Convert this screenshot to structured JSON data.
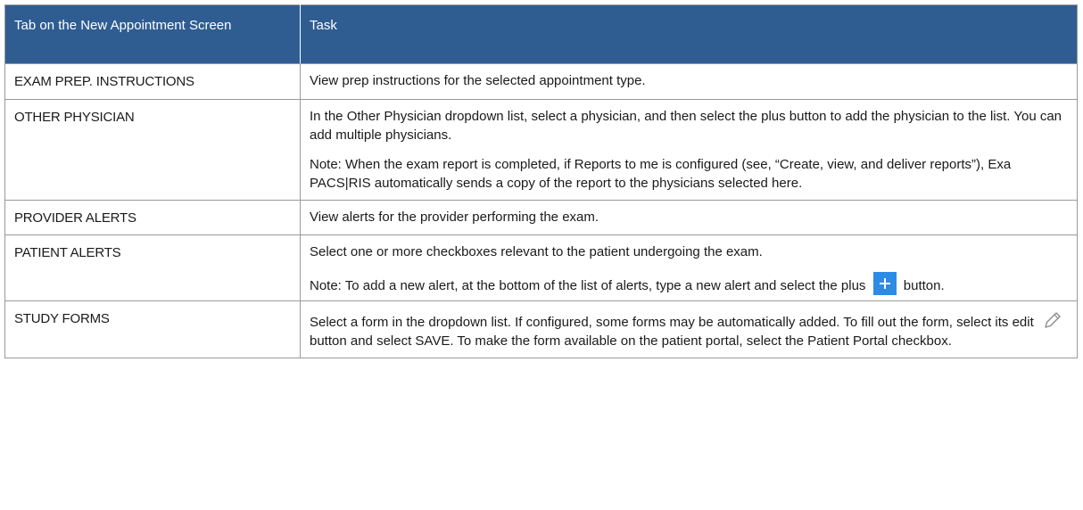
{
  "table": {
    "headers": [
      "Tab on the New Appointment Screen",
      "Task"
    ],
    "rows": {
      "exam_prep": {
        "tab": "EXAM PREP. INSTRUCTIONS",
        "task": [
          "View prep instructions for the selected appointment type."
        ]
      },
      "other_physician": {
        "tab": "OTHER PHYSICIAN",
        "task": [
          "In the Other Physician dropdown list, select a physician, and then select the plus button to add the physician to the list. You can add multiple physicians.",
          "Note: When the exam report is completed, if Reports to me is configured (see, “Create, view, and deliver reports”), Exa PACS|RIS automatically sends a copy of the report to the physicians selected here."
        ]
      },
      "provider_alerts": {
        "tab": "PROVIDER ALERTS",
        "task": [
          "View alerts for the provider performing the exam."
        ]
      },
      "patient_alerts": {
        "tab": "PATIENT ALERTS",
        "task": [
          "Select one or more checkboxes relevant to the patient undergoing the exam.",
          "Note: To add a new alert, at the bottom of the list of alerts, type a new alert and select the plus",
          "button."
        ],
        "icon": "plus-icon"
      },
      "study_forms": {
        "tab": "STUDY FORMS",
        "task": [
          "Select a form in the dropdown list. If configured, some forms may be automatically added. To fill out the form, select its edit",
          "button and select SAVE. To make the form available on the patient portal, select the Patient Portal checkbox."
        ],
        "icon": "pencil-icon"
      }
    }
  },
  "colors": {
    "header_bg": "#2f5d91",
    "header_text": "#ffffff",
    "border": "#9a9a9a",
    "plus_button": "#2b8be6"
  }
}
